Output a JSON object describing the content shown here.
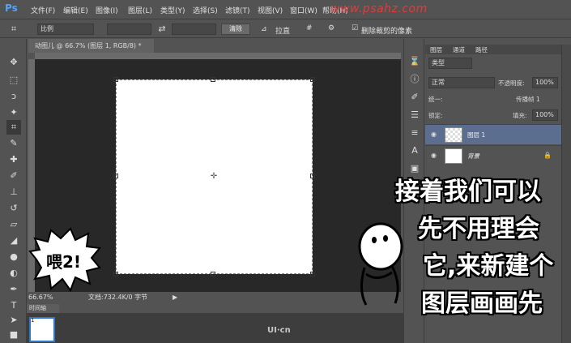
{
  "menubar": {
    "logo": "Ps",
    "items": [
      "文件(F)",
      "编辑(E)",
      "图像(I)",
      "图层(L)",
      "类型(Y)",
      "选择(S)",
      "滤镜(T)",
      "视图(V)",
      "窗口(W)",
      "帮助(H)"
    ],
    "watermark": "www.psahz.com"
  },
  "options": {
    "ratio_label": "比例",
    "clear_button": "清除",
    "straighten_label": "拉直",
    "delete_cropped_label": "删除裁剪的像素"
  },
  "document": {
    "tab_title": "动图儿 @ 66.7% (图层 1, RGB/8) *",
    "zoom": "66.67%",
    "doc_info": "文档:732.4K/0 字节"
  },
  "timeline": {
    "tab_label": "时间轴",
    "frame_number": "1"
  },
  "layers": {
    "tabs": [
      "图层",
      "通道",
      "路径"
    ],
    "kind_label": "类型",
    "blend_mode": "正常",
    "opacity_label": "不透明度:",
    "opacity_value": "100%",
    "unify_label": "统一:",
    "propagate_label": "传播帧 1",
    "lock_label": "锁定:",
    "fill_label": "填充:",
    "fill_value": "100%",
    "items": [
      {
        "name": "图层 1",
        "selected": true
      },
      {
        "name": "背景",
        "selected": false,
        "locked": true
      }
    ]
  },
  "overlay": {
    "bubble_text": "喂2!",
    "caption_lines": [
      "接着我们可以",
      "先不用理会",
      "它,来新建个",
      "图层画画先"
    ],
    "logo": "UI·cn"
  },
  "colors": {
    "ui_bg": "#535353",
    "workspace": "#282828",
    "selected_layer": "#5b6e8f",
    "watermark": "#e23b3b"
  }
}
